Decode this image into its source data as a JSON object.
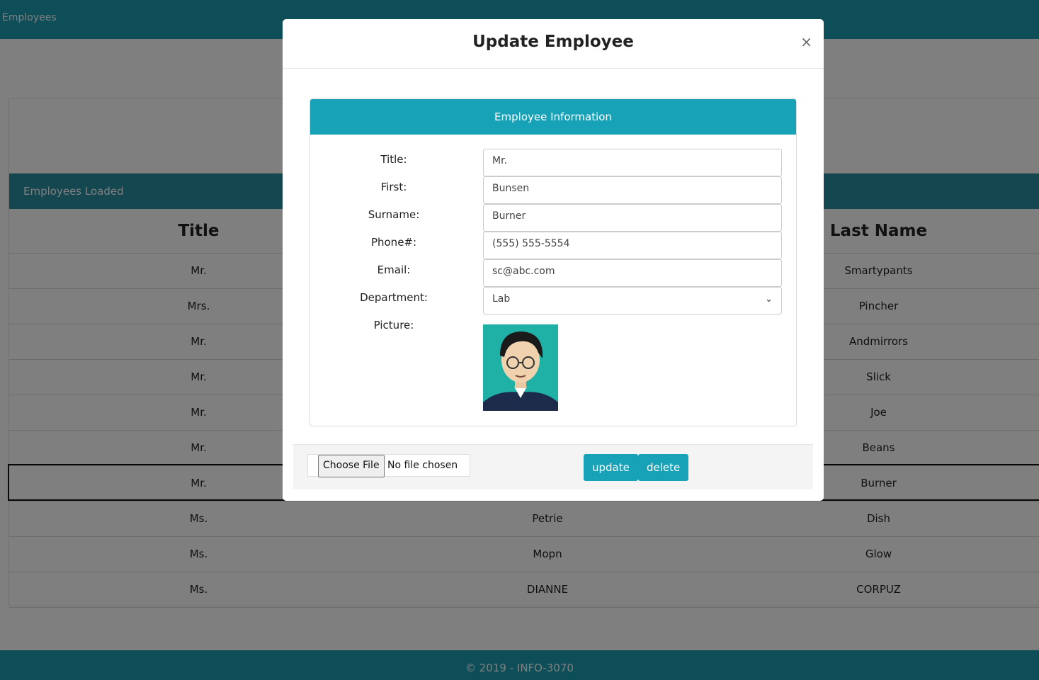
{
  "navbar": {
    "brand": "Employees"
  },
  "table": {
    "header": "Employees Loaded",
    "columns": {
      "title": "Title",
      "last": "Last Name"
    },
    "rows": [
      {
        "title": "Mr.",
        "first": "",
        "last": "Smartypants"
      },
      {
        "title": "Mrs.",
        "first": "",
        "last": "Pincher"
      },
      {
        "title": "Mr.",
        "first": "",
        "last": "Andmirrors"
      },
      {
        "title": "Mr.",
        "first": "",
        "last": "Slick"
      },
      {
        "title": "Mr.",
        "first": "",
        "last": "Joe"
      },
      {
        "title": "Mr.",
        "first": "",
        "last": "Beans"
      },
      {
        "title": "Mr.",
        "first": "",
        "last": "Burner"
      },
      {
        "title": "Ms.",
        "first": "Petrie",
        "last": "Dish"
      },
      {
        "title": "Ms.",
        "first": "Mopn",
        "last": "Glow"
      },
      {
        "title": "Ms.",
        "first": "DIANNE",
        "last": "CORPUZ"
      }
    ]
  },
  "footer": {
    "text": "© 2019 - INFO-3070"
  },
  "modal": {
    "title": "Update Employee",
    "close": "×",
    "card_title": "Employee Information",
    "fields": {
      "title": {
        "label": "Title:",
        "value": "Mr."
      },
      "first": {
        "label": "First:",
        "value": "Bunsen"
      },
      "surname": {
        "label": "Surname:",
        "value": "Burner"
      },
      "phone": {
        "label": "Phone#:",
        "value": "(555) 555-5554"
      },
      "email": {
        "label": "Email:",
        "value": "sc@abc.com"
      },
      "department": {
        "label": "Department:",
        "value": "Lab"
      },
      "picture": {
        "label": "Picture:"
      }
    },
    "file_button": "Choose File",
    "file_status": "No file chosen",
    "update_button": "update",
    "delete_button": "delete"
  },
  "colors": {
    "accent": "#17a2b8",
    "navbar": "#1b9db3",
    "table_header": "#2a8ea3"
  }
}
